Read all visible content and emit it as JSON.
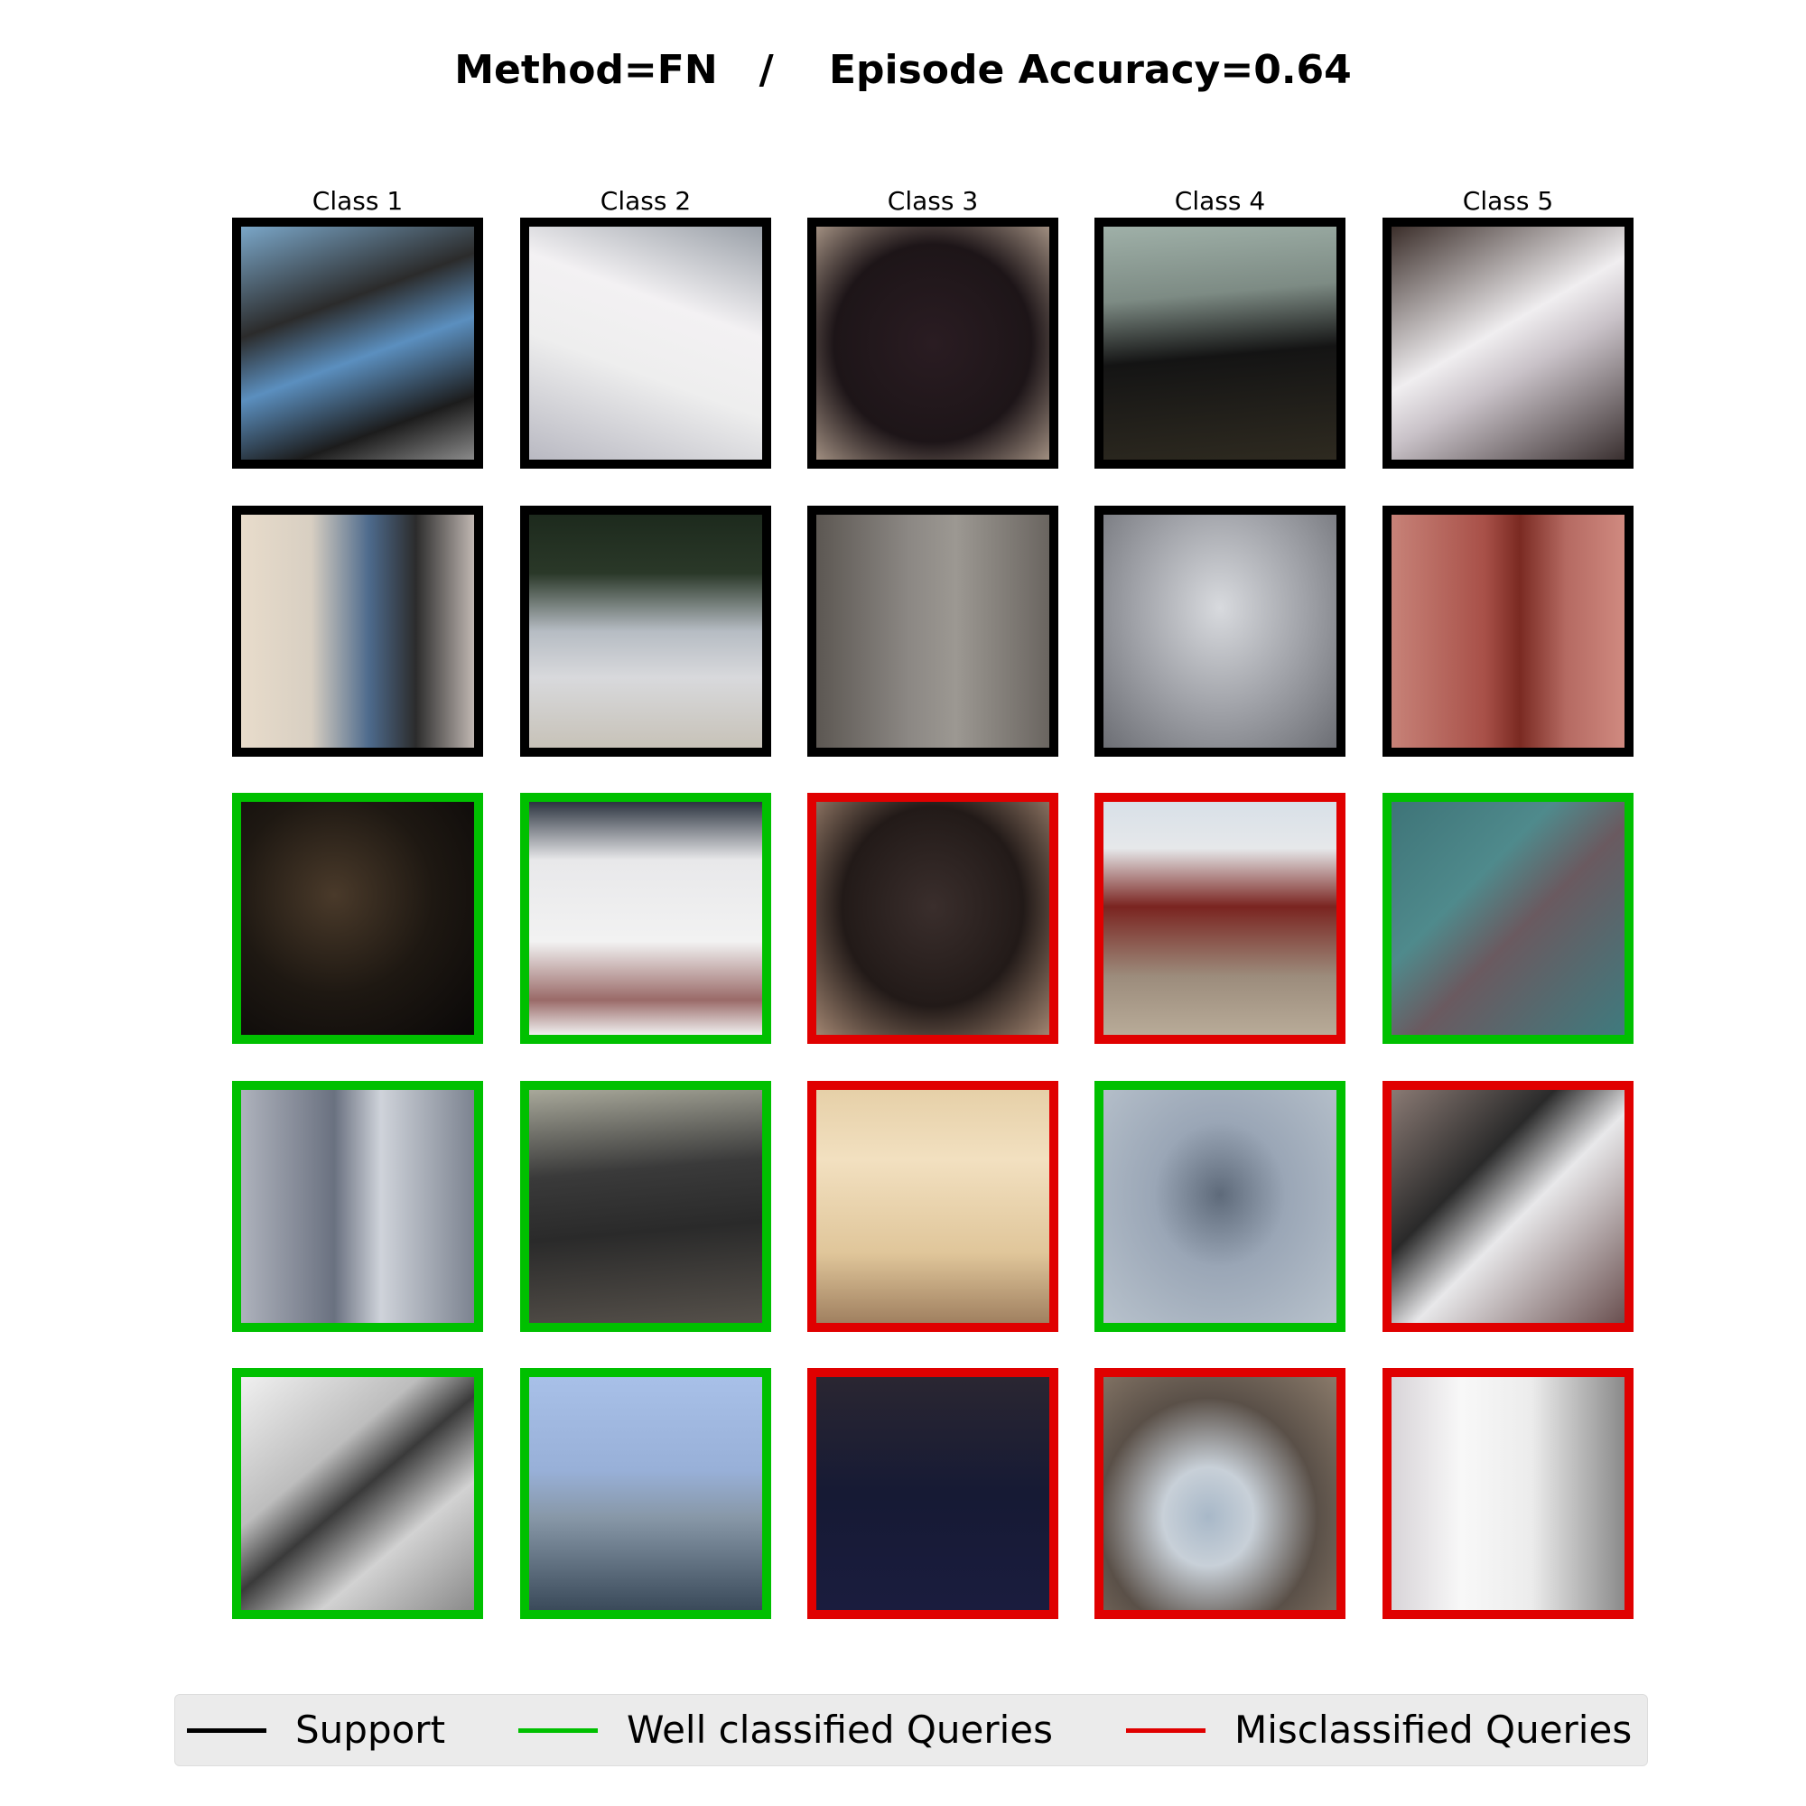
{
  "title": "Method=FN   /    Episode Accuracy=0.64",
  "column_labels": [
    "Class 1",
    "Class 2",
    "Class 3",
    "Class 4",
    "Class 5"
  ],
  "colors": {
    "support": "#000000",
    "well_classified": "#00c000",
    "misclassified": "#e00000"
  },
  "rows": [
    {
      "status": [
        "support",
        "support",
        "support",
        "support",
        "support"
      ]
    },
    {
      "status": [
        "support",
        "support",
        "support",
        "support",
        "support"
      ]
    },
    {
      "status": [
        "well_classified",
        "well_classified",
        "misclassified",
        "misclassified",
        "well_classified"
      ]
    },
    {
      "status": [
        "well_classified",
        "well_classified",
        "misclassified",
        "well_classified",
        "misclassified"
      ]
    },
    {
      "status": [
        "well_classified",
        "well_classified",
        "misclassified",
        "misclassified",
        "misclassified"
      ]
    }
  ],
  "legend": {
    "support": "Support",
    "well_classified": "Well classified Queries",
    "misclassified": "Misclassified Queries"
  }
}
